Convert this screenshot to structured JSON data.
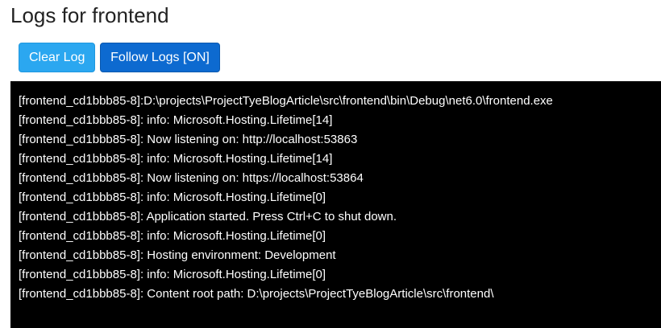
{
  "page": {
    "title": "Logs for frontend"
  },
  "toolbar": {
    "clear_label": "Clear Log",
    "follow_label": "Follow Logs [ON]"
  },
  "log": {
    "lines": [
      "[frontend_cd1bbb85-8]:D:\\projects\\ProjectTyeBlogArticle\\src\\frontend\\bin\\Debug\\net6.0\\frontend.exe",
      "[frontend_cd1bbb85-8]: info: Microsoft.Hosting.Lifetime[14]",
      "[frontend_cd1bbb85-8]: Now listening on: http://localhost:53863",
      "[frontend_cd1bbb85-8]: info: Microsoft.Hosting.Lifetime[14]",
      "[frontend_cd1bbb85-8]: Now listening on: https://localhost:53864",
      "[frontend_cd1bbb85-8]: info: Microsoft.Hosting.Lifetime[0]",
      "[frontend_cd1bbb85-8]: Application started. Press Ctrl+C to shut down.",
      "[frontend_cd1bbb85-8]: info: Microsoft.Hosting.Lifetime[0]",
      "[frontend_cd1bbb85-8]: Hosting environment: Development",
      "[frontend_cd1bbb85-8]: info: Microsoft.Hosting.Lifetime[0]",
      "[frontend_cd1bbb85-8]: Content root path: D:\\projects\\ProjectTyeBlogArticle\\src\\frontend\\"
    ]
  },
  "colors": {
    "clear_button": "#2ba7f0",
    "follow_button": "#0d6ad0",
    "log_background": "#000000",
    "log_text": "#ffffff"
  }
}
